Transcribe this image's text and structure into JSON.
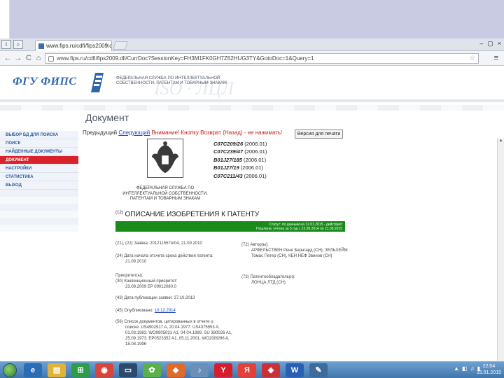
{
  "browser": {
    "tab_title": "www.fips.ru/cdfi/fips2009.dll/Ttl",
    "tab_close": "×",
    "url": "www.fips.ru/cdfi/fips2009.dll/CurrDoc?SessionKey=FH3M1FK0GH7Z62HUG3TY&GotoDoc=1&Query=1",
    "back_label": "←",
    "forward_label": "→",
    "reload_label": "C",
    "home_label": "⌂",
    "window_buttons": [
      "–",
      "▢",
      "×"
    ]
  },
  "site": {
    "logo_text": "ФГУ ФИПС",
    "org_title": "ФЕДЕРАЛЬНАЯ СЛУЖБА ПО ИНТЕЛЛЕКТУАЛЬНОЙ СОБСТВЕННОСТИ, ПАТЕНТАМ И ТОВАРНЫМ ЗНАКАМ",
    "page_title": "Документ"
  },
  "sidenav": [
    {
      "label": "ВЫБОР БД ДЛЯ ПОИСКА",
      "active": false
    },
    {
      "label": "ПОИСК",
      "active": false
    },
    {
      "label": "НАЙДЕННЫЕ ДОКУМЕНТЫ",
      "active": false
    },
    {
      "label": "ДОКУМЕНТ",
      "active": true
    },
    {
      "label": "НАСТРОЙКИ",
      "active": false
    },
    {
      "label": "СТАТИСТИКА",
      "active": false
    },
    {
      "label": "ВЫХОД",
      "active": false
    }
  ],
  "doc_toolbar": {
    "prev": "Предыдущий",
    "next": "Следующий",
    "warning": "Внимание! Кнопку Возврат (Назад) - не нажимать!",
    "print": "Версия для печати"
  },
  "document": {
    "agency": "ФЕДЕРАЛЬНАЯ СЛУЖБА ПО ИНТЕЛЛЕКТУАЛЬНОЙ СОБСТВЕННОСТИ, ПАТЕНТАМ И ТОВАРНЫМ ЗНАКАМ",
    "ipc": [
      {
        "code": "C07C209/26",
        "year": "(2006.01)"
      },
      {
        "code": "C07C239/47",
        "year": "(2006.01)"
      },
      {
        "code": "B01J27/185",
        "year": "(2006.01)"
      },
      {
        "code": "B01J27/19",
        "year": "(2006.01)"
      },
      {
        "code": "C07C211/43",
        "year": "(2006.01)"
      }
    ],
    "desc_num": "(12)",
    "desc_title": "ОПИСАНИЕ ИЗОБРЕТЕНИЯ К ПАТЕНТУ",
    "status_line1": "Статус: по данным на 12.01.2015 - действует",
    "status_line2": "Пошлина: учтена за 5 год с 22.09.2014 по 21.09.2015",
    "application": "(21), (22) Заявка: 2012115574/04, 21.09.2010",
    "start_date_label": "(24) Дата начала отсчета срока действия патента:",
    "start_date": "21.09.2010",
    "priority_label": "Приоритет(ы):",
    "priority": "(30) Конвенционный приоритет:",
    "priority_value": "23.09.2009 EP 09012080.0",
    "published_label": "(43) Дата публикации заявки: 27.10.2013",
    "pub_label": "(45) Опубликовано:",
    "pub_date": "10.12.2014",
    "cited_label": "(56) Список документов, цитированных в отчете о",
    "cited_body": "поиске: US4902917 A, 20.04.1977. US4375553 A, 01.03.1983. WO9905031 A1, 04.04.1999. SU 380026 A1, 25.09.1973. EP0523352 A1, 05.11.2001. WO2009/96 A, 18.08.1996",
    "authors_label": "(72) Автор(ы):",
    "authors_value": "АРФЕЛЬСТВЕН Рене Бернгард (CH), ЗЕЛЬХЕЙМ Томас Петер (CH), КЕН НЕФ Звинов (CH)",
    "owner_label": "(73) Патентообладатель(и):",
    "owner_value": "ЛОНЦА ЛТД (CH)"
  },
  "taskbar": {
    "icons": [
      "e",
      "▤",
      "⊞",
      "◉",
      "▭",
      "✿",
      "◆",
      "♪",
      "Y",
      "Я",
      "◈",
      "W",
      "✎"
    ],
    "tray": [
      "▲",
      "◧",
      "♫",
      "▮"
    ],
    "time": "22:04",
    "date": "15.01.2015"
  },
  "colors": {
    "accent_blue": "#2f67ad",
    "active_nav": "#d8232a",
    "status_green": "#1a8a1a",
    "link": "#1e45b8",
    "warning_red": "#c51d1d"
  }
}
